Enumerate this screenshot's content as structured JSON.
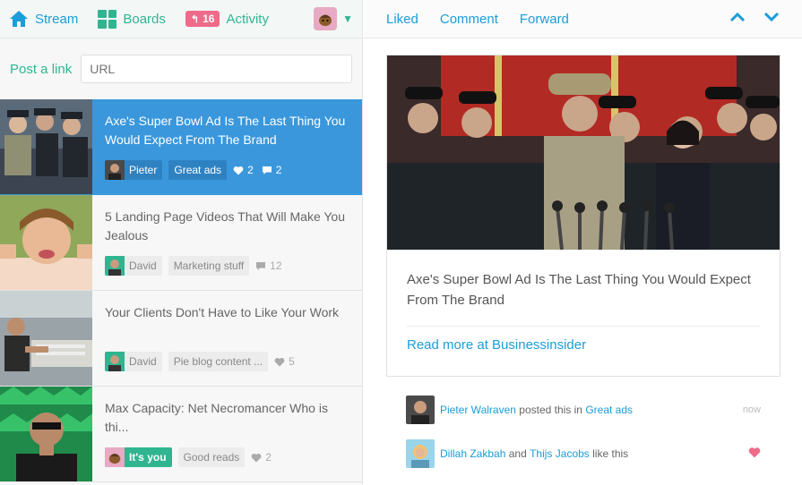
{
  "nav": {
    "stream": "Stream",
    "boards": "Boards",
    "activity_count": "16",
    "activity": "Activity"
  },
  "post": {
    "label": "Post a link",
    "url_placeholder": "URL"
  },
  "feed": [
    {
      "title": "Axe's Super Bowl Ad Is The Last Thing You Would Expect From The Brand",
      "author": "Pieter",
      "board": "Great ads",
      "likes": "2",
      "comments": "2"
    },
    {
      "title": "5 Landing Page Videos That Will Make You Jealous",
      "author": "David",
      "board": "Marketing stuff",
      "comments": "12"
    },
    {
      "title": "Your Clients Don't Have to Like Your Work",
      "author": "David",
      "board": "Pie blog content ...",
      "likes": "5"
    },
    {
      "title": "Max Capacity: Net Necromancer Who is thi...",
      "author": "It's you",
      "board": "Good reads",
      "likes": "2"
    }
  ],
  "detail": {
    "actions": {
      "liked": "Liked",
      "comment": "Comment",
      "forward": "Forward"
    },
    "title": "Axe's Super Bowl Ad Is The Last Thing You Would Expect From The Brand",
    "read_more": "Read more at Businessinsider"
  },
  "activity": [
    {
      "name": "Pieter Walraven",
      "text": "posted this in",
      "board": "Great ads",
      "time": "now"
    },
    {
      "name": "Dillah Zakbah",
      "and": "and",
      "name2": "Thijs Jacobs",
      "text": "like this"
    }
  ],
  "colors": {
    "accent_blue": "#1a9dd9",
    "accent_green": "#2fb590",
    "active_item": "#3a97dc",
    "badge_pink": "#f06a8a",
    "heart": "#f06a8a"
  }
}
